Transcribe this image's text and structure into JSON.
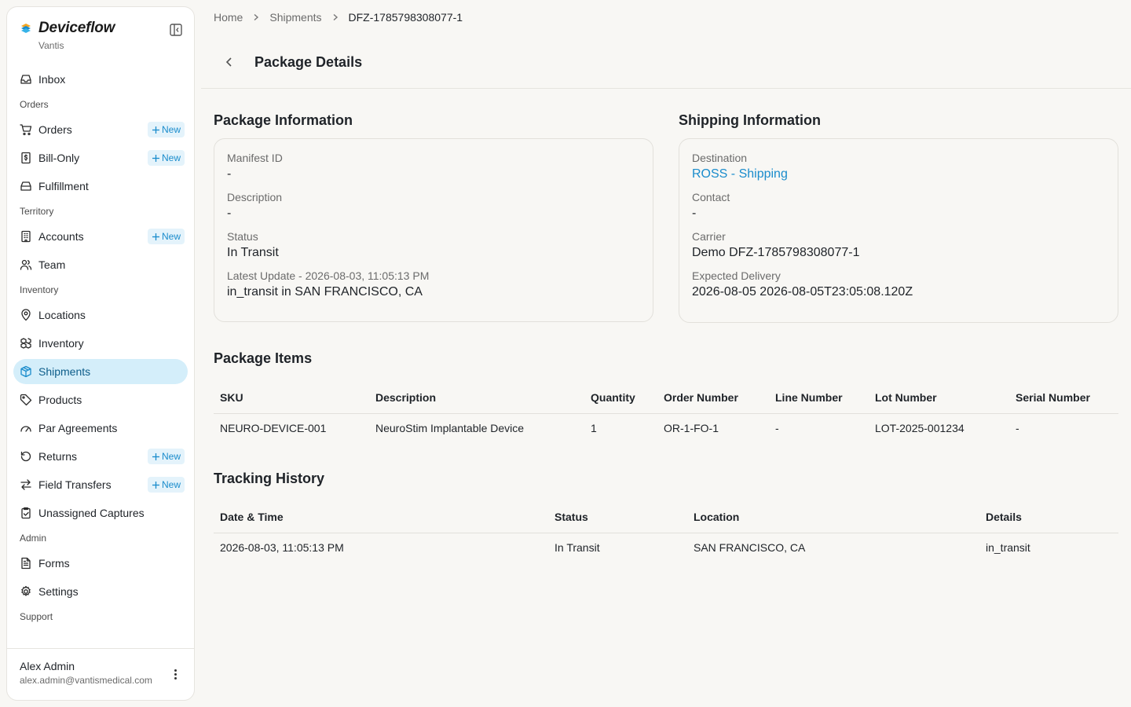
{
  "brand": {
    "name": "Deviceflow",
    "org": "Vantis"
  },
  "sidebar": {
    "items": [
      {
        "type": "item",
        "key": "inbox",
        "label": "Inbox",
        "icon": "inbox-icon"
      },
      {
        "type": "section",
        "label": "Orders"
      },
      {
        "type": "item",
        "key": "orders",
        "label": "Orders",
        "icon": "cart-icon",
        "badge": "New"
      },
      {
        "type": "item",
        "key": "bill-only",
        "label": "Bill-Only",
        "icon": "invoice-icon",
        "badge": "New"
      },
      {
        "type": "item",
        "key": "fulfillment",
        "label": "Fulfillment",
        "icon": "tray-icon"
      },
      {
        "type": "section",
        "label": "Territory"
      },
      {
        "type": "item",
        "key": "accounts",
        "label": "Accounts",
        "icon": "building-icon",
        "badge": "New"
      },
      {
        "type": "item",
        "key": "team",
        "label": "Team",
        "icon": "users-icon"
      },
      {
        "type": "section",
        "label": "Inventory"
      },
      {
        "type": "item",
        "key": "locations",
        "label": "Locations",
        "icon": "map-pin-icon"
      },
      {
        "type": "item",
        "key": "inventory",
        "label": "Inventory",
        "icon": "boxes-icon"
      },
      {
        "type": "item",
        "key": "shipments",
        "label": "Shipments",
        "icon": "package-icon",
        "active": true
      },
      {
        "type": "item",
        "key": "products",
        "label": "Products",
        "icon": "tag-icon"
      },
      {
        "type": "item",
        "key": "par-agreements",
        "label": "Par Agreements",
        "icon": "gauge-icon"
      },
      {
        "type": "item",
        "key": "returns",
        "label": "Returns",
        "icon": "rotate-ccw-icon",
        "badge": "New"
      },
      {
        "type": "item",
        "key": "field-transfers",
        "label": "Field Transfers",
        "icon": "arrows-swap-icon",
        "badge": "New"
      },
      {
        "type": "item",
        "key": "unassigned-captures",
        "label": "Unassigned Captures",
        "icon": "clipboard-check-icon"
      },
      {
        "type": "section",
        "label": "Admin"
      },
      {
        "type": "item",
        "key": "forms",
        "label": "Forms",
        "icon": "file-text-icon"
      },
      {
        "type": "item",
        "key": "settings",
        "label": "Settings",
        "icon": "gear-icon"
      },
      {
        "type": "section",
        "label": "Support"
      }
    ]
  },
  "user": {
    "name": "Alex Admin",
    "email": "alex.admin@vantismedical.com"
  },
  "breadcrumb": {
    "home": "Home",
    "shipments": "Shipments",
    "current": "DFZ-1785798308077-1"
  },
  "page": {
    "title": "Package Details"
  },
  "package_info": {
    "title": "Package Information",
    "manifest_label": "Manifest ID",
    "manifest_value": "-",
    "description_label": "Description",
    "description_value": "-",
    "status_label": "Status",
    "status_value": "In Transit",
    "update_label": "Latest Update - 2026-08-03, 11:05:13 PM",
    "update_value": "in_transit in SAN FRANCISCO, CA"
  },
  "shipping_info": {
    "title": "Shipping Information",
    "destination_label": "Destination",
    "destination_value": "ROSS - Shipping",
    "contact_label": "Contact",
    "contact_value": "-",
    "carrier_label": "Carrier",
    "carrier_value": "Demo DFZ-1785798308077-1",
    "delivery_label": "Expected Delivery",
    "delivery_value": "2026-08-05 2026-08-05T23:05:08.120Z"
  },
  "package_items": {
    "title": "Package Items",
    "columns": [
      "SKU",
      "Description",
      "Quantity",
      "Order Number",
      "Line Number",
      "Lot Number",
      "Serial Number"
    ],
    "rows": [
      [
        "NEURO-DEVICE-001",
        "NeuroStim Implantable Device",
        "1",
        "OR-1-FO-1",
        "-",
        "LOT-2025-001234",
        "-"
      ]
    ]
  },
  "tracking": {
    "title": "Tracking History",
    "columns": [
      "Date & Time",
      "Status",
      "Location",
      "Details"
    ],
    "rows": [
      [
        "2026-08-03, 11:05:13 PM",
        "In Transit",
        "SAN FRANCISCO, CA",
        "in_transit"
      ]
    ]
  },
  "colors": {
    "accent": "#1a8ccc",
    "active_bg": "#d4eefa",
    "badge_bg": "#e4f3fb",
    "page_bg": "#f8f7f4"
  }
}
